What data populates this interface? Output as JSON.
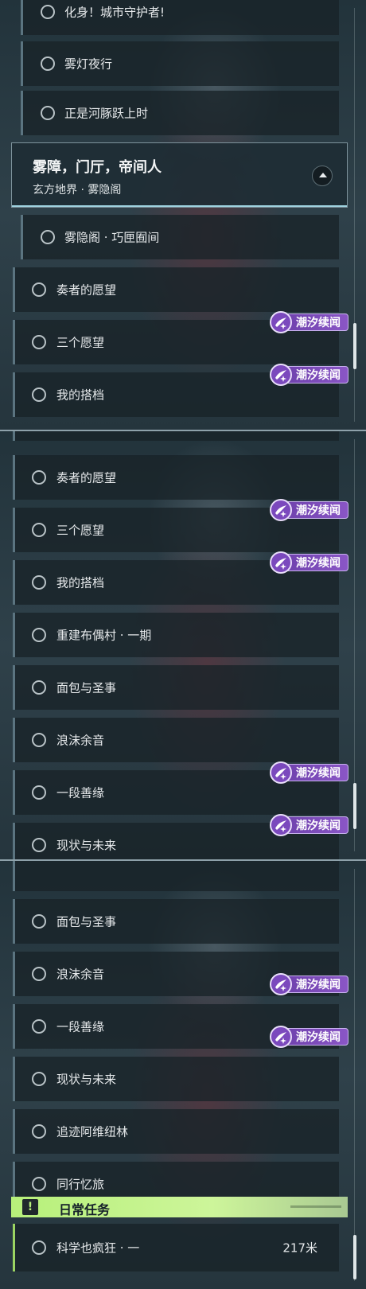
{
  "badge_label": "潮汐续闻",
  "panel1": {
    "top_rows": [
      "化身！城市守护者!",
      "雾灯夜行",
      "正是河豚跃上时"
    ],
    "chapter": {
      "title": "雾障，门厅，帝间人",
      "subtitle": "玄方地界 · 雾隐阁"
    },
    "chapter_rows": [
      "雾隐阁 · 巧匣囿间"
    ],
    "rows": [
      "奏者的愿望",
      "三个愿望",
      "我的搭档"
    ]
  },
  "panel2": {
    "rows": [
      "奏者的愿望",
      "三个愿望",
      "我的搭档",
      "重建布偶村 · 一期",
      "面包与圣事",
      "浪沫余音",
      "一段善缘",
      "现状与未来"
    ]
  },
  "panel3": {
    "rows": [
      "面包与圣事",
      "浪沫余音",
      "一段善缘",
      "现状与未来",
      "追迹阿维纽林",
      "同行忆旅"
    ],
    "daily": {
      "label": "日常任务",
      "icon": "!"
    },
    "daily_rows": [
      {
        "label": "科学也疯狂 · 一",
        "distance": "217米"
      }
    ]
  },
  "icons": {
    "quest_status": "circle-outline-icon",
    "badge": "tide-sparkle-icon",
    "collapse": "chevron-up-icon",
    "daily": "exclamation-icon"
  }
}
